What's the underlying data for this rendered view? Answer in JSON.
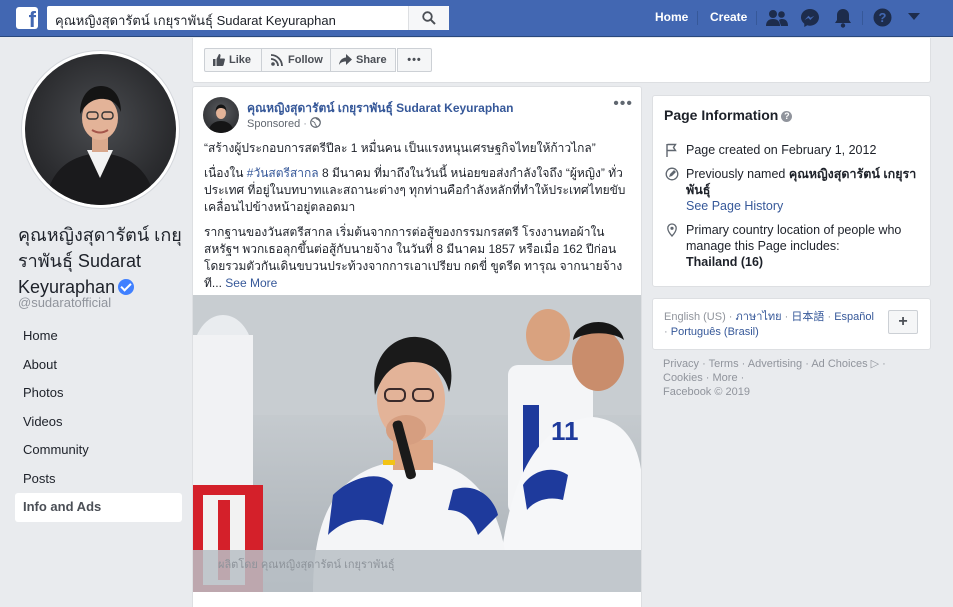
{
  "topbar": {
    "search_value": "คุณหญิงสุดารัตน์ เกยุราพันธุ์ Sudarat Keyuraphan",
    "home_label": "Home",
    "create_label": "Create",
    "logo_letter": "f"
  },
  "profile": {
    "name": "คุณหญิงสุดารัตน์ เกยุราพันธุ์ Sudarat Keyuraphan",
    "handle": "@sudaratofficial"
  },
  "side_nav": [
    {
      "label": "Home",
      "active": false
    },
    {
      "label": "About",
      "active": false
    },
    {
      "label": "Photos",
      "active": false
    },
    {
      "label": "Videos",
      "active": false
    },
    {
      "label": "Community",
      "active": false
    },
    {
      "label": "Posts",
      "active": false
    },
    {
      "label": "Info and Ads",
      "active": true
    }
  ],
  "actions": {
    "like": "Like",
    "follow": "Follow",
    "share": "Share",
    "more": "•••"
  },
  "post": {
    "author": "คุณหญิงสุดารัตน์ เกยุราพันธุ์ Sudarat Keyuraphan",
    "sponsored": "Sponsored",
    "more": "•••",
    "line1": "“สร้างผู้ประกอบการสตรีปีละ 1 หมื่นคน เป็นแรงหนุนเศรษฐกิจไทยให้ก้าวไกล”",
    "p2_before": "เนื่องใน ",
    "hashtag": "#วันสตรีสากล",
    "p2_after": " 8 มีนาคม ที่มาถึงในวันนี้ หน่อยขอส่งกำลังใจถึง “ผู้หญิง” ทั่วประเทศ ที่อยู่ในบทบาทและสถานะต่างๆ ทุกท่านคือกำลังหลักที่ทำให้ประเทศไทยขับเคลื่อนไปข้างหน้าอยู่ตลอดมา",
    "p3": "รากฐานของวันสตรีสากล เริ่มต้นจากการต่อสู้ของกรรมกรสตรี โรงงานทอผ้าในสหรัฐฯ พวกเธอลุกขึ้นต่อสู้กับนายจ้าง ในวันที่ 8 มีนาคม 1857 หรือเมื่อ 162 ปีก่อน โดยรวมตัวกันเดินขบวนประท้วงจากการเอาเปรียบ กดขี่ ขูดรีด ทารุณ จากนายจ้าง ที",
    "ellipsis": "... ",
    "see_more": "See More",
    "image_caption": "ผลิตโดย คุณหญิงสุดารัตน์ เกยุราพันธุ์",
    "sign_number": "11"
  },
  "page_info": {
    "title": "Page Information",
    "help": "?",
    "created": "Page created on February 1, 2012",
    "prev_label": "Previously named ",
    "prev_name": "คุณหญิงสุดารัตน์ เกยุราพันธุ์",
    "history_link": "See Page History",
    "country_label": "Primary country location of people who manage this Page includes:",
    "country": "Thailand (16)"
  },
  "languages": {
    "current": "English (US)",
    "sep": " · ",
    "others": [
      "ภาษาไทย",
      "日本語",
      "Español",
      "Português (Brasil)"
    ],
    "plus": "+"
  },
  "footer": {
    "line1": "Privacy · Terms · Advertising · Ad Choices ▷ ·",
    "line2": "Cookies · More ·",
    "line3": "Facebook © 2019"
  },
  "colors": {
    "brand": "#4267b2",
    "link": "#365899",
    "verified": "#4080ff"
  }
}
